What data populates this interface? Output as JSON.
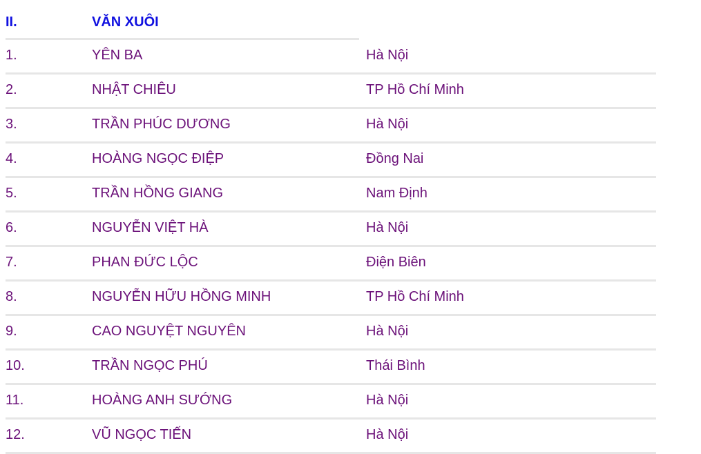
{
  "section": {
    "number": "II.",
    "title": "VĂN XUÔI"
  },
  "colors": {
    "header_text": "#1010e0",
    "row_text": "#6b1179",
    "divider": "#e6e6e6"
  },
  "rows": [
    {
      "index": "1.",
      "name": "YÊN BA",
      "place": "Hà Nội"
    },
    {
      "index": "2.",
      "name": "NHẬT CHIÊU",
      "place": "TP Hồ Chí Minh"
    },
    {
      "index": "3.",
      "name": "TRẦN PHÚC DƯƠNG",
      "place": "Hà Nội"
    },
    {
      "index": "4.",
      "name": "HOÀNG NGỌC ĐIỆP",
      "place": "Đồng Nai"
    },
    {
      "index": "5.",
      "name": "TRẦN HỒNG GIANG",
      "place": "Nam Định"
    },
    {
      "index": "6.",
      "name": "NGUYỄN VIỆT HÀ",
      "place": "Hà Nội"
    },
    {
      "index": "7.",
      "name": "PHAN ĐỨC LỘC",
      "place": "Điện Biên"
    },
    {
      "index": "8.",
      "name": "NGUYỄN HỮU HỒNG MINH",
      "place": "TP Hồ Chí Minh"
    },
    {
      "index": "9.",
      "name": "CAO NGUYỆT NGUYÊN",
      "place": "Hà Nội"
    },
    {
      "index": "10.",
      "name": "TRẦN NGỌC PHÚ",
      "place": "Thái Bình"
    },
    {
      "index": "11.",
      "name": "HOÀNG ANH SƯỚNG",
      "place": "Hà Nội"
    },
    {
      "index": "12.",
      "name": "VŨ NGỌC TIẾN",
      "place": "Hà Nội"
    }
  ]
}
